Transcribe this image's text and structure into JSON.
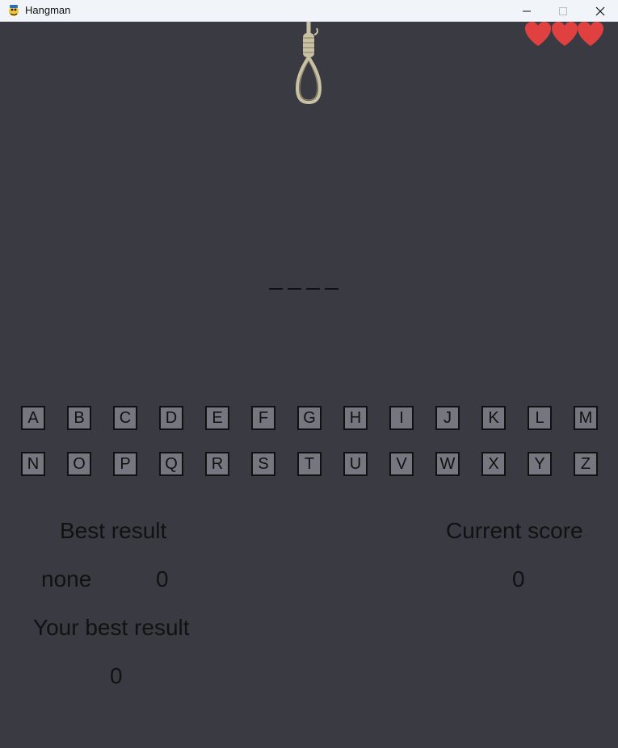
{
  "window": {
    "title": "Hangman"
  },
  "lives": 3,
  "word_length": 4,
  "keyboard": {
    "row1": [
      "A",
      "B",
      "C",
      "D",
      "E",
      "F",
      "G",
      "H",
      "I",
      "J",
      "K",
      "L",
      "M"
    ],
    "row2": [
      "N",
      "O",
      "P",
      "Q",
      "R",
      "S",
      "T",
      "U",
      "V",
      "W",
      "X",
      "Y",
      "Z"
    ]
  },
  "scores": {
    "best_result_label": "Best result",
    "best_result_name": "none",
    "best_result_value": "0",
    "current_score_label": "Current score",
    "current_score_value": "0",
    "your_best_label": "Your best result",
    "your_best_value": "0"
  },
  "colors": {
    "background": "#3a3b42",
    "key_fill": "#75767f",
    "heart": "#e0403f",
    "rope": "#c9c1a3"
  }
}
